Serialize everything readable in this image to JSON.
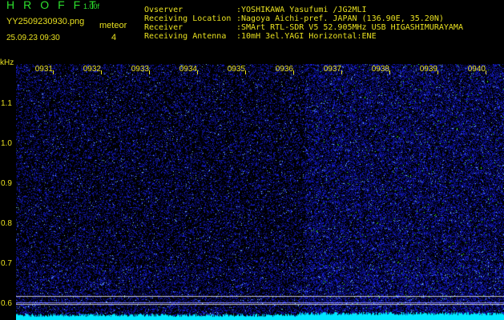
{
  "app": {
    "title": "HROFFT",
    "version": "1.00f"
  },
  "file": {
    "name": "YY2509230930.png",
    "datetime": "25.09.23 09:30",
    "count_label": "meteor",
    "count": "4"
  },
  "info": [
    {
      "label": "Ovserver",
      "value": ":YOSHIKAWA Yasufumi /JG2MLI"
    },
    {
      "label": "Receiving Location",
      "value": ":Nagoya Aichi-pref. JAPAN (136.90E, 35.20N)"
    },
    {
      "label": "Receiver",
      "value": ":SMArt RTL-SDR V5 52.905MHz USB HIGASHIMURAYAMA"
    },
    {
      "label": "Receiving Antenna",
      "value": ":10mH 3el.YAGI Horizontal:ENE"
    }
  ],
  "axis": {
    "unit": "kHz",
    "x_ticks": [
      "0931",
      "0932",
      "0933",
      "0934",
      "0935",
      "0936",
      "0937",
      "0938",
      "0939",
      "0940"
    ],
    "y_ticks": [
      "1.1",
      "1.0",
      "0.9",
      "0.8",
      "0.7",
      "0.6"
    ]
  },
  "colors": {
    "noise": "#1a2aff",
    "baseline": "#00e8ff",
    "text": "#e8e020",
    "title": "#2de02d"
  }
}
